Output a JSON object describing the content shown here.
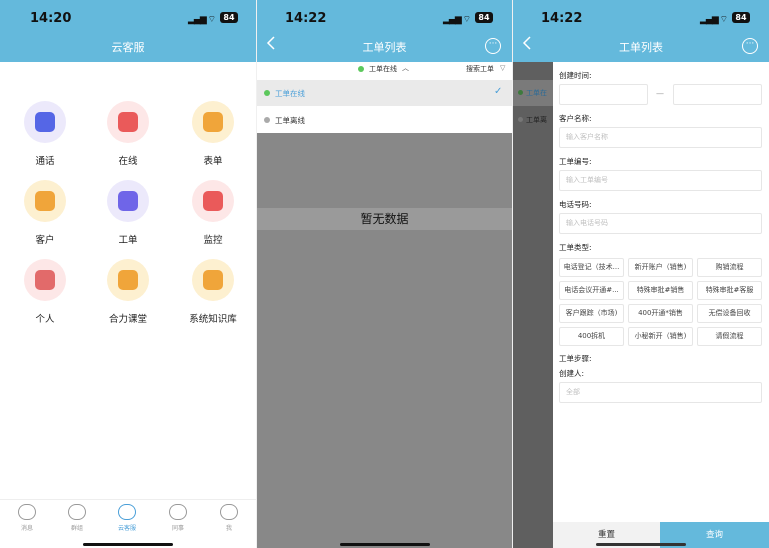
{
  "status": {
    "p1_time": "14:20",
    "p2_time": "14:22",
    "p3_time": "14:22",
    "battery": "84"
  },
  "screen1": {
    "title": "云客服",
    "tiles": [
      {
        "label": "通话",
        "icon": "phone-icon",
        "bg": "#ece9fb",
        "fg": "#5566e6"
      },
      {
        "label": "在线",
        "icon": "chat-bubble-icon",
        "bg": "#fde7e7",
        "fg": "#ea5a5a"
      },
      {
        "label": "表单",
        "icon": "form-icon",
        "bg": "#fdf0d0",
        "fg": "#f0a53a"
      },
      {
        "label": "客户",
        "icon": "customer-icon",
        "bg": "#fdf0d0",
        "fg": "#f0a53a"
      },
      {
        "label": "工单",
        "icon": "ticket-icon",
        "bg": "#ece9fb",
        "fg": "#6f65e8"
      },
      {
        "label": "监控",
        "icon": "monitor-icon",
        "bg": "#fde7e7",
        "fg": "#ea5a5a"
      },
      {
        "label": "个人",
        "icon": "person-icon",
        "bg": "#fde7e7",
        "fg": "#e26a6a"
      },
      {
        "label": "合力课堂",
        "icon": "classroom-icon",
        "bg": "#fdf0d0",
        "fg": "#f0a53a"
      },
      {
        "label": "系统知识库",
        "icon": "knowledge-base-icon",
        "bg": "#fdf0d0",
        "fg": "#f0a53a"
      }
    ],
    "tabbar": [
      {
        "label": "消息",
        "icon": "message-icon",
        "active": false
      },
      {
        "label": "群组",
        "icon": "group-icon",
        "active": false
      },
      {
        "label": "云客服",
        "icon": "cloud-icon",
        "active": true
      },
      {
        "label": "同事",
        "icon": "colleague-icon",
        "active": false
      },
      {
        "label": "我",
        "icon": "me-icon",
        "active": false
      }
    ]
  },
  "screen2": {
    "title": "工单列表",
    "filter_label": "工单在线",
    "search_label": "搜索工单",
    "options": [
      {
        "label": "工单在线",
        "selected": true
      },
      {
        "label": "工单离线",
        "selected": false
      }
    ],
    "empty_text": "暂无数据"
  },
  "screen3": {
    "title": "工单列表",
    "peek_labels": [
      "工单在",
      "工单离"
    ],
    "labels": {
      "created_time": "创建时间:",
      "customer_name": "客户名称:",
      "ticket_no": "工单编号:",
      "phone": "电话号码:",
      "ticket_type": "工单类型:",
      "ticket_step": "工单步骤:",
      "creator": "创建人:"
    },
    "placeholders": {
      "customer_name": "输入客户名称",
      "ticket_no": "输入工单编号",
      "phone": "输入电话号码",
      "creator": "全部"
    },
    "date_separator": "—",
    "types": [
      "电话登记（技术...",
      "新开账户（销售)",
      "购销流程",
      "电话会议开通#...",
      "特殊审批#销售",
      "特殊审批#客服",
      "客户跟踪（市场)",
      "400开通*销售",
      "无偿设备回收",
      "400拆机",
      "小秘新开（销售)",
      "请假流程"
    ],
    "reset_label": "重置",
    "query_label": "查询"
  },
  "colors": {
    "header": "#64b9dc",
    "accent": "#4a9fd8",
    "online_dot": "#5cc85c",
    "offline_dot": "#aaaaaa"
  }
}
